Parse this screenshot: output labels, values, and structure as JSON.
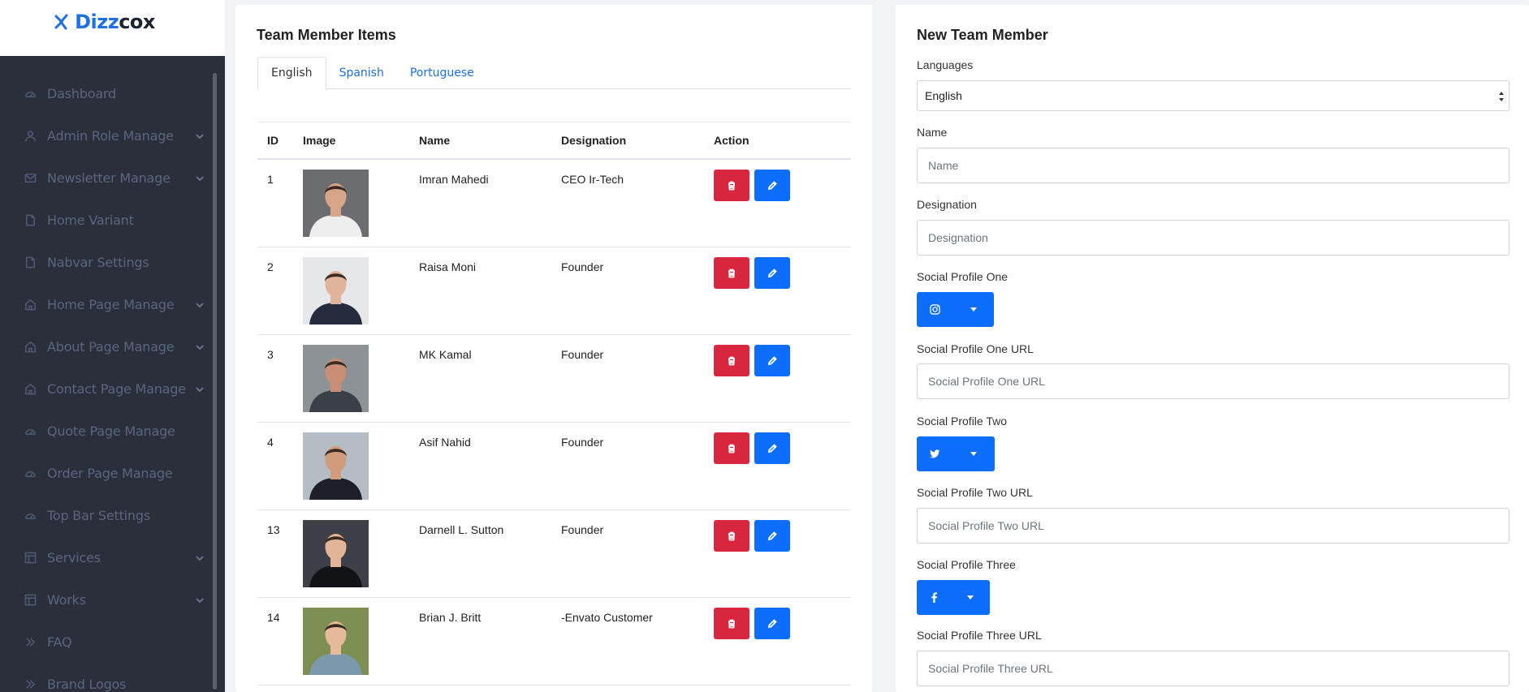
{
  "brand": {
    "part1": "Dizz",
    "part2": "cox"
  },
  "sidebar": {
    "items": [
      {
        "label": "Dashboard",
        "icon": "dashboard-icon",
        "has_submenu": false
      },
      {
        "label": "Admin Role Manage",
        "icon": "user-icon",
        "has_submenu": true
      },
      {
        "label": "Newsletter Manage",
        "icon": "mail-icon",
        "has_submenu": true
      },
      {
        "label": "Home Variant",
        "icon": "file-icon",
        "has_submenu": false
      },
      {
        "label": "Nabvar Settings",
        "icon": "file-icon",
        "has_submenu": false
      },
      {
        "label": "Home Page Manage",
        "icon": "home-icon",
        "has_submenu": true
      },
      {
        "label": "About Page Manage",
        "icon": "home-icon",
        "has_submenu": true
      },
      {
        "label": "Contact Page Manage",
        "icon": "home-icon",
        "has_submenu": true
      },
      {
        "label": "Quote Page Manage",
        "icon": "dashboard-icon",
        "has_submenu": false
      },
      {
        "label": "Order Page Manage",
        "icon": "dashboard-icon",
        "has_submenu": false
      },
      {
        "label": "Top Bar Settings",
        "icon": "dashboard-icon",
        "has_submenu": false
      },
      {
        "label": "Services",
        "icon": "layout-icon",
        "has_submenu": true
      },
      {
        "label": "Works",
        "icon": "layout-icon",
        "has_submenu": true
      },
      {
        "label": "FAQ",
        "icon": "double-chevron-icon",
        "has_submenu": false
      },
      {
        "label": "Brand Logos",
        "icon": "double-chevron-icon",
        "has_submenu": false
      }
    ]
  },
  "team_list": {
    "title": "Team Member Items",
    "tabs": [
      {
        "label": "English",
        "active": true
      },
      {
        "label": "Spanish",
        "active": false
      },
      {
        "label": "Portuguese",
        "active": false
      }
    ],
    "columns": [
      "ID",
      "Image",
      "Name",
      "Designation",
      "Action"
    ],
    "rows": [
      {
        "id": "1",
        "name": "Imran Mahedi",
        "designation": "CEO Ir-Tech",
        "bg": "#6b6d70",
        "shirt": "#eeeeee",
        "skin": "#d7a587"
      },
      {
        "id": "2",
        "name": "Raisa Moni",
        "designation": "Founder",
        "bg": "#e5e7ea",
        "shirt": "#252c3d",
        "skin": "#e0b49a"
      },
      {
        "id": "3",
        "name": "MK Kamal",
        "designation": "Founder",
        "bg": "#8d9296",
        "shirt": "#3a3f48",
        "skin": "#c98f74"
      },
      {
        "id": "4",
        "name": "Asif Nahid",
        "designation": "Founder",
        "bg": "#b4bcc4",
        "shirt": "#1c1f26",
        "skin": "#d09c7c"
      },
      {
        "id": "13",
        "name": "Darnell L. Sutton",
        "designation": "Founder",
        "bg": "#3d4046",
        "shirt": "#121317",
        "skin": "#e1b596"
      },
      {
        "id": "14",
        "name": "Brian J. Britt",
        "designation": "-Envato Customer",
        "bg": "#7d8f52",
        "shirt": "#7c98ac",
        "skin": "#e6bb9b"
      }
    ]
  },
  "form": {
    "title": "New Team Member",
    "languages_label": "Languages",
    "languages_value": "English",
    "name_label": "Name",
    "name_placeholder": "Name",
    "designation_label": "Designation",
    "designation_placeholder": "Designation",
    "social1_label": "Social Profile One",
    "social1_icon": "instagram-icon",
    "social1_url_label": "Social Profile One URL",
    "social1_url_placeholder": "Social Profile One URL",
    "social2_label": "Social Profile Two",
    "social2_icon": "twitter-icon",
    "social2_url_label": "Social Profile Two URL",
    "social2_url_placeholder": "Social Profile Two URL",
    "social3_label": "Social Profile Three",
    "social3_icon": "facebook-icon",
    "social3_url_label": "Social Profile Three URL",
    "social3_url_placeholder": "Social Profile Three URL"
  },
  "colors": {
    "sidebar_bg": "#2b2f3b",
    "primary": "#0d6efd",
    "danger": "#d7263d",
    "brand_blue": "#1e6fe8"
  }
}
